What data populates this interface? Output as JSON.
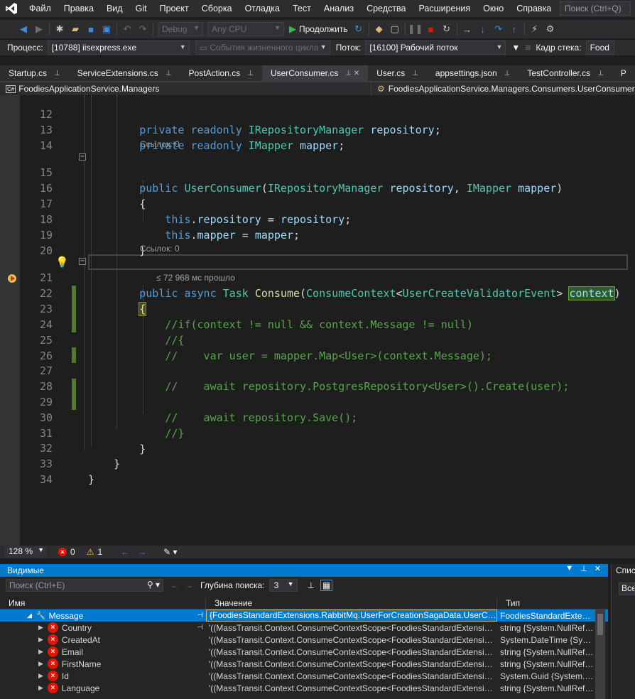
{
  "menu": {
    "items": [
      "Файл",
      "Правка",
      "Вид",
      "Git",
      "Проект",
      "Сборка",
      "Отладка",
      "Тест",
      "Анализ",
      "Средства",
      "Расширения",
      "Окно",
      "Справка"
    ],
    "search_placeholder": "Поиск (Ctrl+Q)"
  },
  "toolbar": {
    "config": "Debug",
    "platform": "Any CPU",
    "continue_label": "Продолжить"
  },
  "process_bar": {
    "process_label": "Процесс:",
    "process_value": "[10788] iisexpress.exe",
    "lifecycle_label": "События жизненного цикла",
    "thread_label": "Поток:",
    "thread_value": "[16100] Рабочий поток",
    "stack_label": "Кадр стека:",
    "stack_value": "Food"
  },
  "tabs": [
    {
      "label": "Startup.cs",
      "active": false
    },
    {
      "label": "ServiceExtensions.cs",
      "active": false
    },
    {
      "label": "PostAction.cs",
      "active": false
    },
    {
      "label": "UserConsumer.cs",
      "active": true
    },
    {
      "label": "User.cs",
      "active": false
    },
    {
      "label": "appsettings.json",
      "active": false
    },
    {
      "label": "TestController.cs",
      "active": false
    },
    {
      "label": "P",
      "active": false
    }
  ],
  "nav": {
    "project": "FoodiesApplicationService.Managers",
    "class": "FoodiesApplicationService.Managers.Consumers.UserConsumer"
  },
  "editor": {
    "refs_label": "Ссылок: 0",
    "elapsed_hint": "≤ 72 968 мс прошло",
    "lines": {
      "12": "private readonly IRepositoryManager repository;",
      "13": "private readonly IMapper mapper;",
      "15": "public UserConsumer(IRepositoryManager repository, IMapper mapper)",
      "21": "public async Task Consume(ConsumeContext<UserCreateValidatorEvent> context)",
      "23": "//if(context != null && context.Message != null)",
      "24": "//{",
      "25": "//    var user = mapper.Map<User>(context.Message);",
      "27": "//    await repository.PostgresRepository<User>().Create(user);",
      "29": "//    await repository.Save();",
      "30": "//}"
    }
  },
  "status": {
    "zoom": "128 %",
    "errors": "0",
    "warnings": "1"
  },
  "watch": {
    "title": "Видимые",
    "search_placeholder": "Поиск (Ctrl+E)",
    "depth_label": "Глубина поиска:",
    "depth_value": "3",
    "columns": [
      "Имя",
      "Значение",
      "Тип"
    ],
    "rows": [
      {
        "name": "Message",
        "value": "{FoodiesStandardExtensions.RabbitMq.UserForCreationSagaData.UserCreat...",
        "type": "FoodiesStandardExtens...",
        "selected": true,
        "error": false
      },
      {
        "name": "Country",
        "value": "'((MassTransit.Context.ConsumeContextScope<FoodiesStandardExtensions...",
        "type": "string {System.NullRefe...",
        "selected": false,
        "error": true
      },
      {
        "name": "CreatedAt",
        "value": "'((MassTransit.Context.ConsumeContextScope<FoodiesStandardExtensions...",
        "type": "System.DateTime {Syst...",
        "selected": false,
        "error": true
      },
      {
        "name": "Email",
        "value": "'((MassTransit.Context.ConsumeContextScope<FoodiesStandardExtensions...",
        "type": "string {System.NullRefe...",
        "selected": false,
        "error": true
      },
      {
        "name": "FirstName",
        "value": "'((MassTransit.Context.ConsumeContextScope<FoodiesStandardExtensions...",
        "type": "string {System.NullRefe...",
        "selected": false,
        "error": true
      },
      {
        "name": "Id",
        "value": "'((MassTransit.Context.ConsumeContextScope<FoodiesStandardExtensions...",
        "type": "System.Guid {System.N...",
        "selected": false,
        "error": true
      },
      {
        "name": "Language",
        "value": "'((MassTransit.Context.ConsumeContextScope<FoodiesStandardExtensions...",
        "type": "string {System.NullRefe...",
        "selected": false,
        "error": true
      }
    ]
  },
  "side_panel": {
    "title": "Спис",
    "button": "Все"
  }
}
